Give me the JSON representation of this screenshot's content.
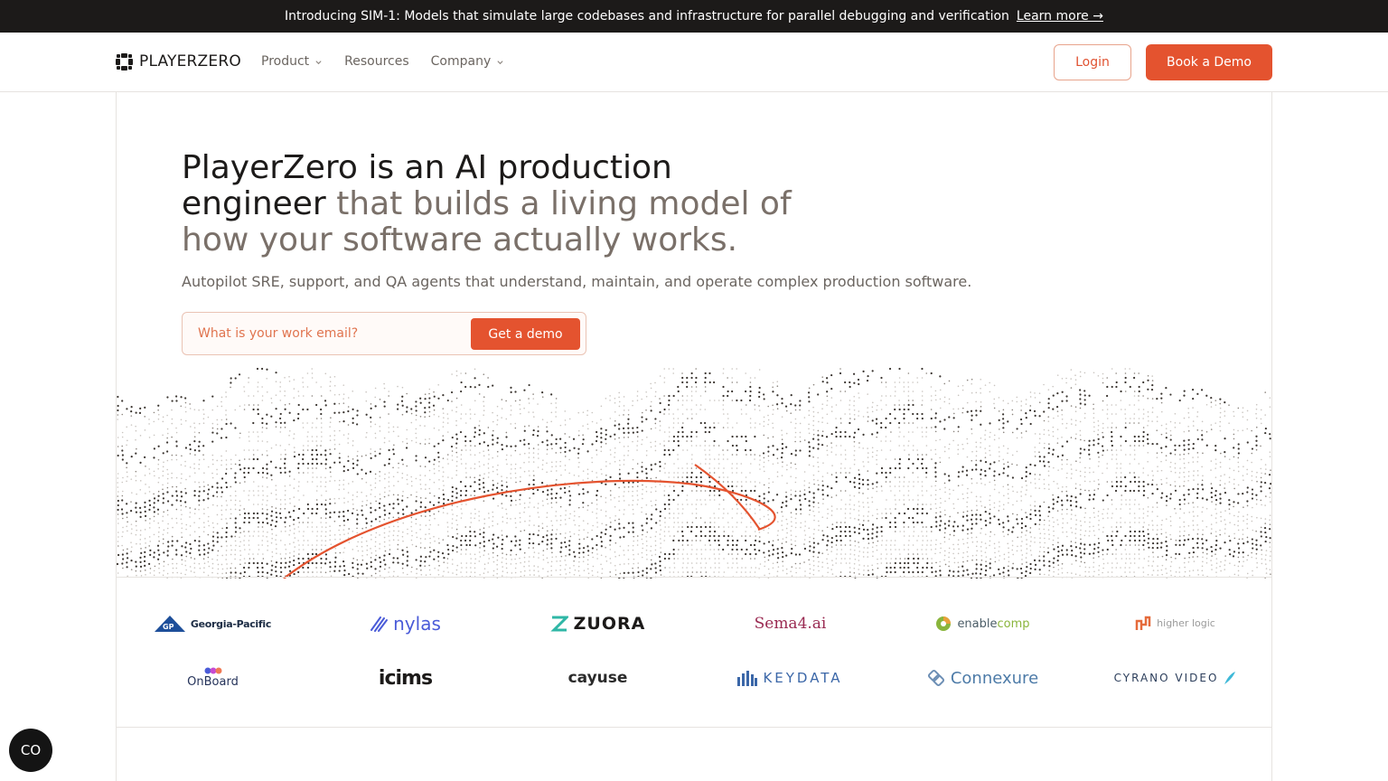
{
  "announcement": {
    "text": "Introducing SIM-1: Models that simulate large codebases and infrastructure for parallel debugging and verification",
    "link": "Learn more →"
  },
  "nav": {
    "brand": "PLAYERZERO",
    "links": [
      "Product",
      "Resources",
      "Company"
    ],
    "login": "Login",
    "book_demo": "Book a Demo"
  },
  "hero": {
    "title_dark": "PlayerZero is an AI production engineer",
    "title_muted": "that builds a living model of how your software actually works.",
    "subtitle": "Autopilot SRE, support, and QA agents that understand, maintain, and operate complex production software.",
    "email_placeholder": "What is your work email?",
    "email_button": "Get a demo"
  },
  "customers": {
    "row1": [
      "Georgia-Pacific",
      "nylas",
      "ZUORA",
      "Sema4.ai",
      "enablecomp",
      "higher logic"
    ],
    "row2": [
      "OnBoard",
      "icims",
      "cayuse",
      "KEYDATA",
      "Connexure",
      "CYRANO VIDEO"
    ]
  },
  "colors": {
    "accent": "#e4532f",
    "dark": "#1c1a19",
    "muted": "#7a7069"
  },
  "chat_widget": {
    "label": "CO"
  }
}
